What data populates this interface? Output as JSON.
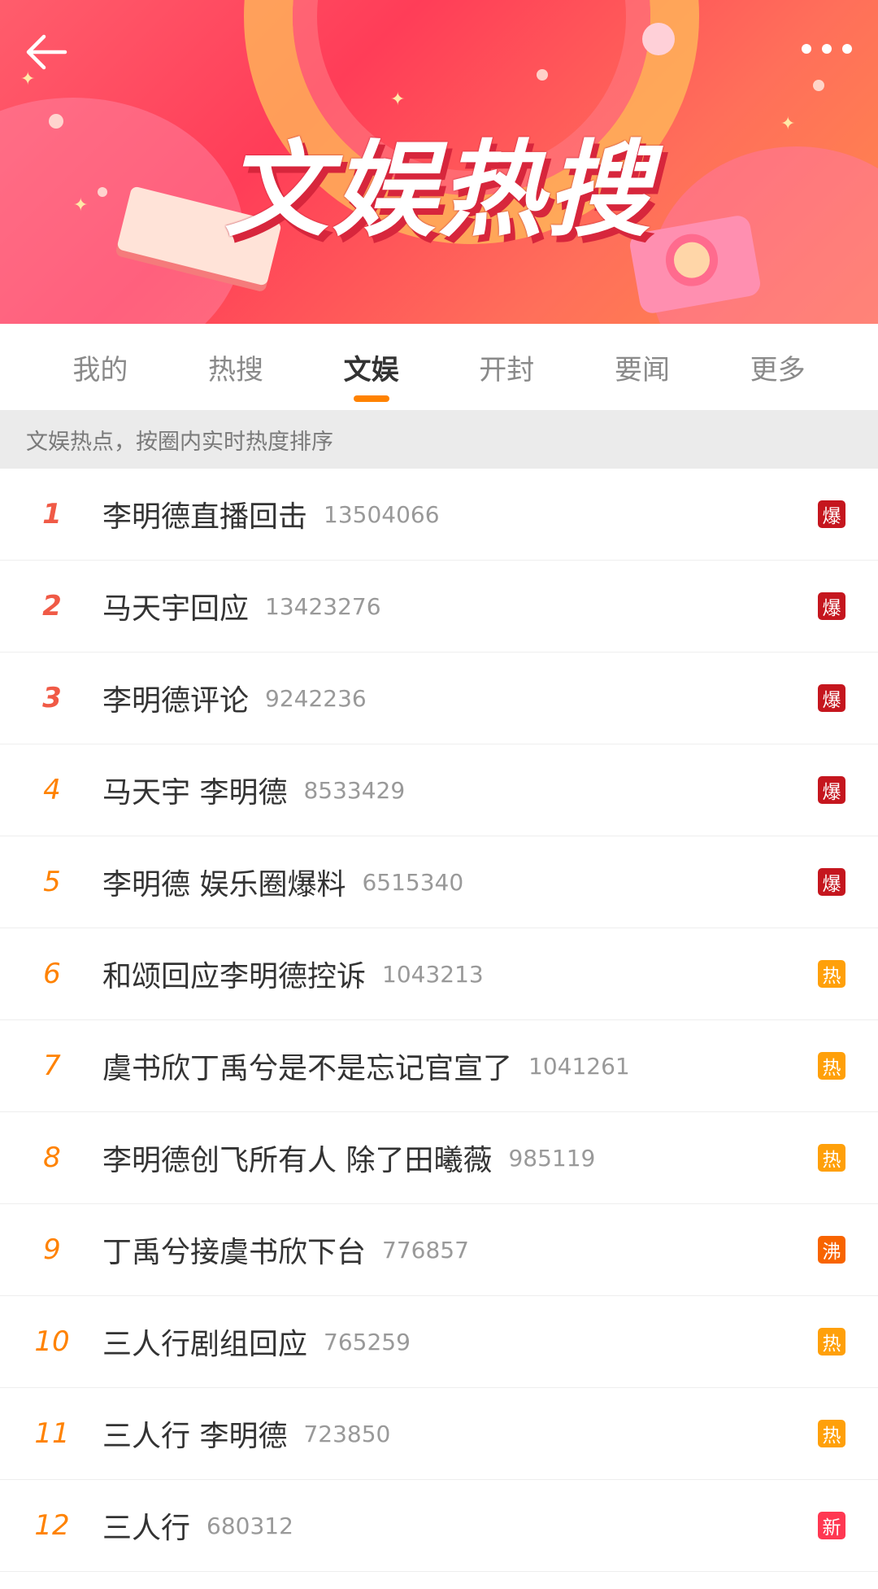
{
  "banner": {
    "title": "文娱热搜"
  },
  "tabs": [
    {
      "label": "我的",
      "active": false
    },
    {
      "label": "热搜",
      "active": false
    },
    {
      "label": "文娱",
      "active": true
    },
    {
      "label": "开封",
      "active": false
    },
    {
      "label": "要闻",
      "active": false
    },
    {
      "label": "更多",
      "active": false
    }
  ],
  "hint": "文娱热点，按圈内实时热度排序",
  "badge_colors": {
    "爆": "#c5161e",
    "热": "#ffa00a",
    "沸": "#f86400",
    "新": "#ff3852"
  },
  "items": [
    {
      "rank": "1",
      "title": "李明德直播回击",
      "count": "13504066",
      "badge": "爆"
    },
    {
      "rank": "2",
      "title": "马天宇回应",
      "count": "13423276",
      "badge": "爆"
    },
    {
      "rank": "3",
      "title": "李明德评论",
      "count": "9242236",
      "badge": "爆"
    },
    {
      "rank": "4",
      "title": "马天宇 李明德",
      "count": "8533429",
      "badge": "爆"
    },
    {
      "rank": "5",
      "title": "李明德 娱乐圈爆料",
      "count": "6515340",
      "badge": "爆"
    },
    {
      "rank": "6",
      "title": "和颂回应李明德控诉",
      "count": "1043213",
      "badge": "热"
    },
    {
      "rank": "7",
      "title": "虞书欣丁禹兮是不是忘记官宣了",
      "count": "1041261",
      "badge": "热"
    },
    {
      "rank": "8",
      "title": "李明德创飞所有人 除了田曦薇",
      "count": "985119",
      "badge": "热"
    },
    {
      "rank": "9",
      "title": "丁禹兮接虞书欣下台",
      "count": "776857",
      "badge": "沸"
    },
    {
      "rank": "10",
      "title": "三人行剧组回应",
      "count": "765259",
      "badge": "热"
    },
    {
      "rank": "11",
      "title": "三人行 李明德",
      "count": "723850",
      "badge": "热"
    },
    {
      "rank": "12",
      "title": "三人行",
      "count": "680312",
      "badge": "新"
    }
  ]
}
